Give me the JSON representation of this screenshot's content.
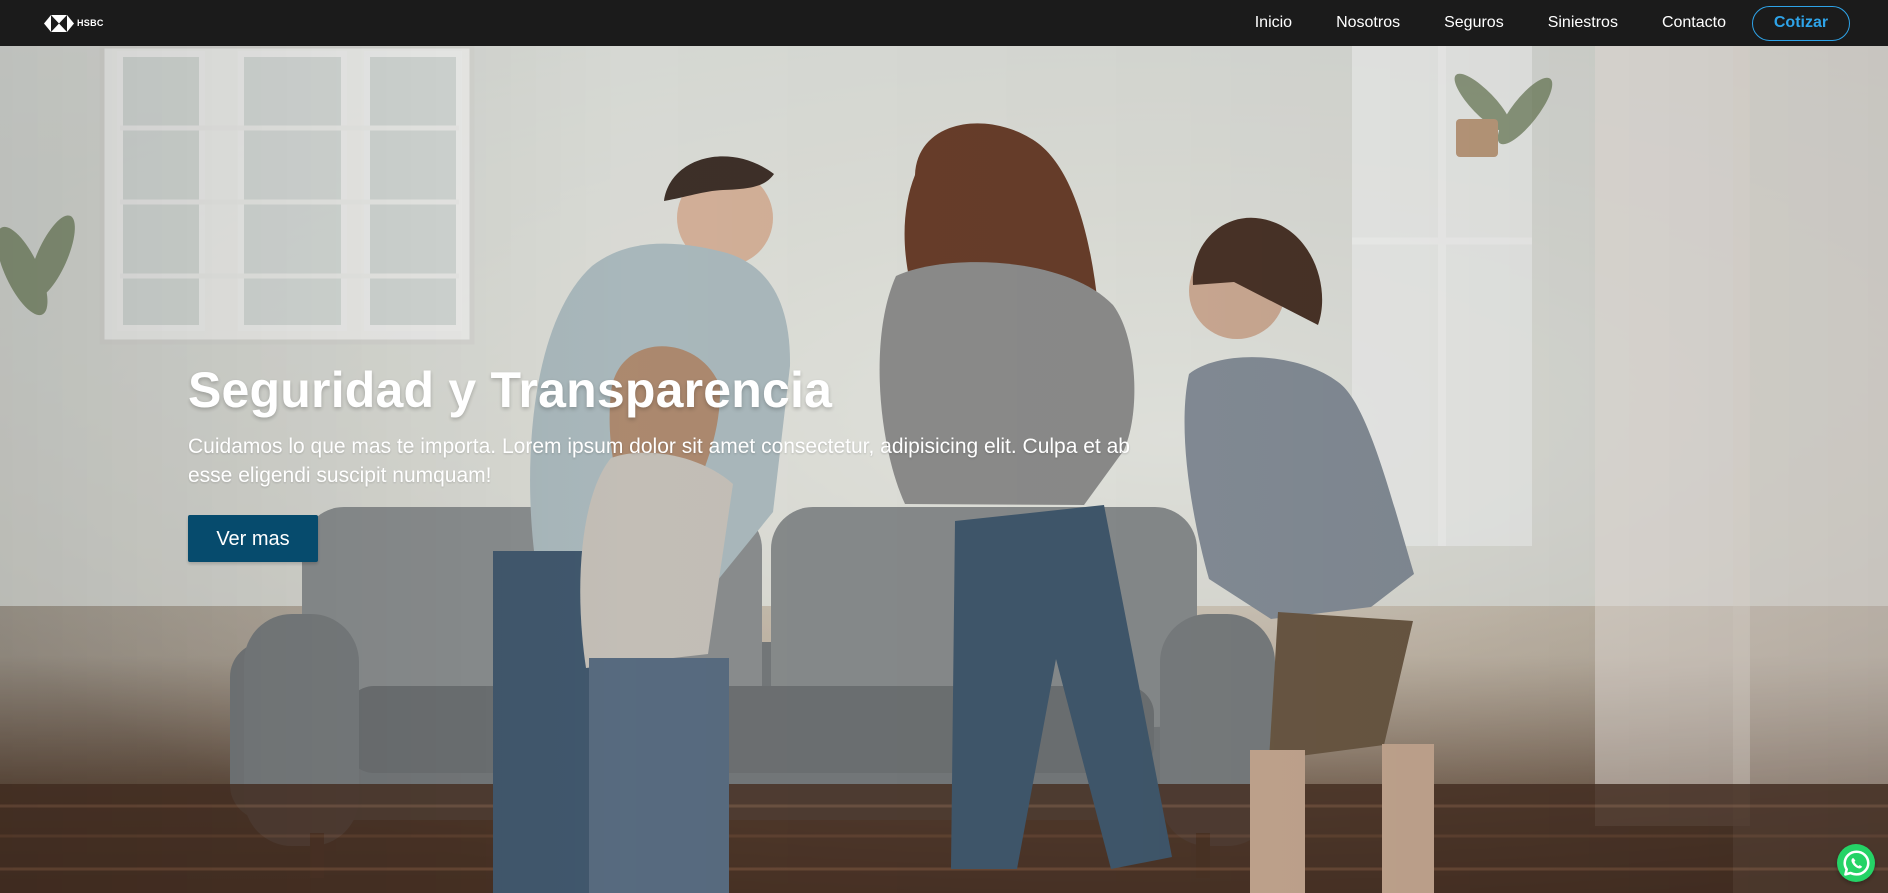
{
  "nav": {
    "brand": "HSBC",
    "items": [
      {
        "label": "Inicio"
      },
      {
        "label": "Nosotros"
      },
      {
        "label": "Seguros"
      },
      {
        "label": "Siniestros"
      },
      {
        "label": "Contacto"
      }
    ],
    "cta": "Cotizar",
    "accent_color": "#2ea3e8"
  },
  "hero": {
    "title": "Seguridad y Transparencia",
    "description": "Cuidamos lo que mas te importa. Lorem ipsum dolor sit amet consectetur, adipisicing elit. Culpa et ab esse eligendi suscipit numquam!",
    "button": "Ver mas",
    "button_color": "#064b6d"
  },
  "icons": {
    "brand": "hsbc-logo-icon",
    "floating": "whatsapp-icon"
  }
}
